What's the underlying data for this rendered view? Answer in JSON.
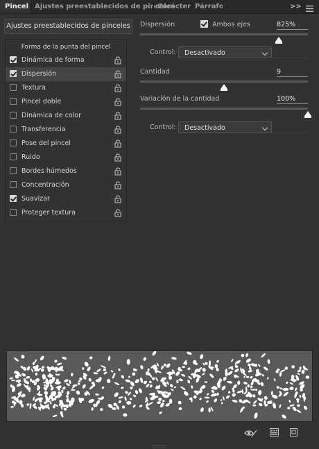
{
  "tabs": [
    {
      "label": "Pincel",
      "active": true
    },
    {
      "label": "Ajustes preestablecidos de pinceles",
      "active": false
    },
    {
      "label": "Carácter",
      "active": false
    },
    {
      "label": "Párrafo",
      "active": false
    }
  ],
  "tabbar": {
    "collapse_label": ">>",
    "menu_icon": "hamburger-menu-icon"
  },
  "sidebar": {
    "preset_button": "Ajustes preestablecidos de pinceles",
    "list_header": "Forma de la punta del pincel",
    "items": [
      {
        "label": "Dinámica de forma",
        "checked": true,
        "selected": false
      },
      {
        "label": "Dispersión",
        "checked": true,
        "selected": true
      },
      {
        "label": "Textura",
        "checked": false,
        "selected": false
      },
      {
        "label": "Pincel doble",
        "checked": false,
        "selected": false
      },
      {
        "label": "Dinámica de color",
        "checked": false,
        "selected": false
      },
      {
        "label": "Transferencia",
        "checked": false,
        "selected": false
      },
      {
        "label": "Pose del pincel",
        "checked": false,
        "selected": false
      },
      {
        "label": "Ruido",
        "checked": false,
        "selected": false
      },
      {
        "label": "Bordes húmedos",
        "checked": false,
        "selected": false
      },
      {
        "label": "Concentración",
        "checked": false,
        "selected": false
      },
      {
        "label": "Suavizar",
        "checked": true,
        "selected": false
      },
      {
        "label": "Proteger textura",
        "checked": false,
        "selected": false
      }
    ]
  },
  "settings": {
    "dispersion": {
      "label": "Dispersión",
      "both_axes_label": "Ambos ejes",
      "both_axes_checked": true,
      "value": "825%",
      "slider_fraction": 0.825
    },
    "control1": {
      "label": "Control:",
      "value": "Desactivado"
    },
    "count": {
      "label": "Cantidad",
      "value": "9",
      "slider_fraction": 0.5
    },
    "count_jitter": {
      "label": "Variación de la cantidad",
      "value": "100%",
      "slider_fraction": 1.0
    },
    "control2": {
      "label": "Control:",
      "value": "Desactivado"
    }
  },
  "footer": {
    "icons": [
      "eye-slash-icon",
      "grid-icon",
      "new-document-icon"
    ]
  },
  "colors": {
    "panel": "#323232",
    "tabbar": "#282828",
    "preview_bg": "#595959",
    "text": "#cfcfcf",
    "accent": "#efefef"
  }
}
